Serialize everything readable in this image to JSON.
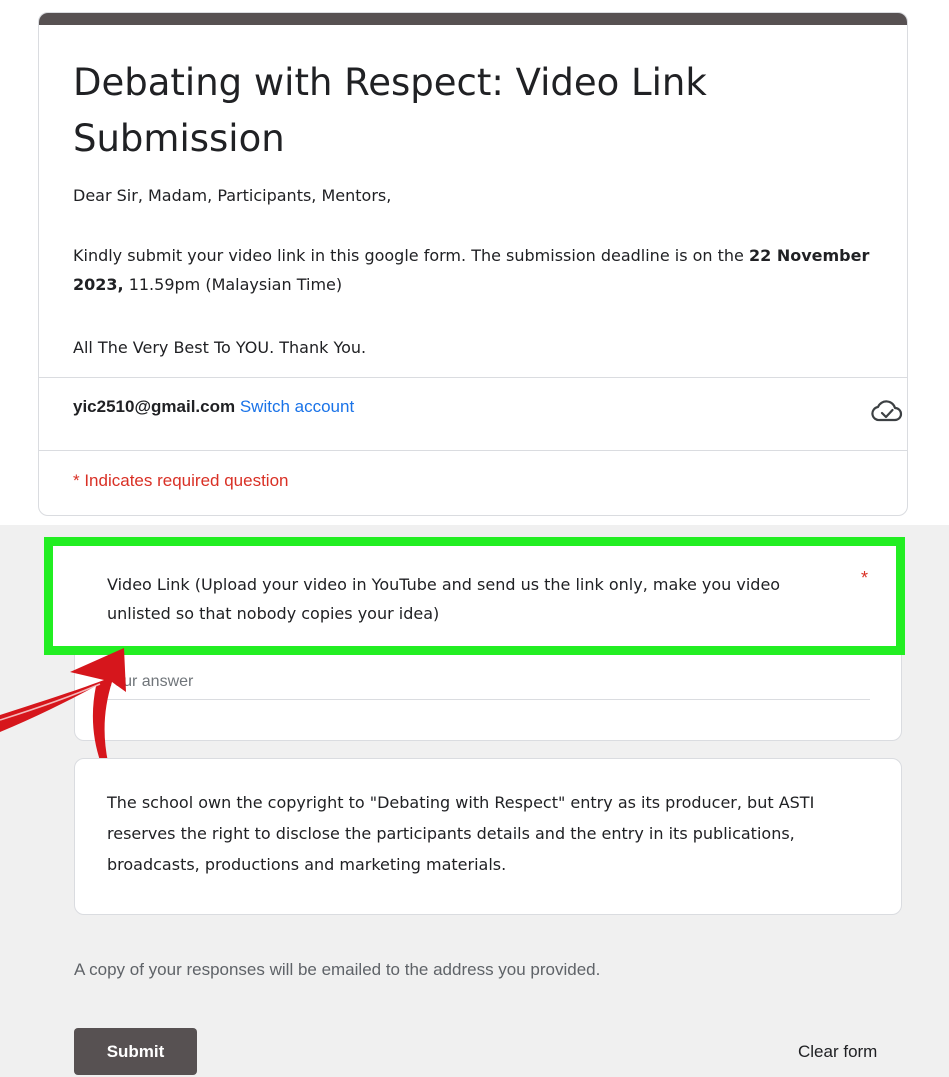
{
  "header": {
    "title": "Debating with Respect: Video Link Submission",
    "greeting": "Dear Sir, Madam, Participants, Mentors,",
    "deadline_prefix": "Kindly submit your video link in this google form. The submission deadline is on the ",
    "deadline_date": "22 November 2023",
    "deadline_comma": ",",
    "deadline_suffix": " 11.59pm (Malaysian Time)",
    "closing": "All The Very Best To YOU. Thank You.",
    "accent_color": "#575152"
  },
  "account": {
    "email": "yic2510@gmail.com",
    "switch_label": "Switch account",
    "cloud_icon": "cloud-check-icon"
  },
  "required_note": "* Indicates required question",
  "question": {
    "title": "Video Link (Upload your video in YouTube and send us the link only, make you video unlisted so that nobody copies your idea)",
    "required_marker": "*",
    "answer_placeholder": "Your answer",
    "answer_value": ""
  },
  "info": {
    "text": "The school own the copyright to \"Debating with Respect\" entry as its producer, but ASTI reserves the right to disclose the participants details and the entry in its publications, broadcasts, productions and marketing materials."
  },
  "footer": {
    "copy_note": "A copy of your responses will be emailed to the address you provided.",
    "submit_label": "Submit",
    "clear_label": "Clear form"
  },
  "colors": {
    "highlight": "#22ee22",
    "arrow": "#d6161c",
    "required": "#d93025",
    "link": "#1a73e8"
  }
}
